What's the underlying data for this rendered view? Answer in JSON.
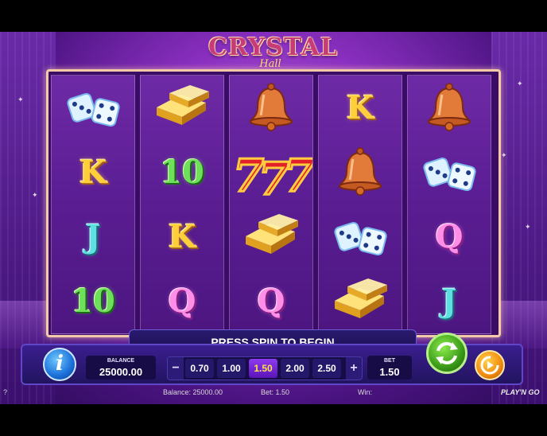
{
  "game": {
    "logo_main": "CRYSTAL",
    "logo_sub": "Hall"
  },
  "reels": [
    [
      "dice",
      "K",
      "J",
      "10"
    ],
    [
      "gold",
      "10",
      "K",
      "Q"
    ],
    [
      "bell",
      "seven",
      "gold",
      "Q"
    ],
    [
      "K",
      "bell",
      "dice",
      "gold"
    ],
    [
      "bell",
      "dice",
      "Q",
      "J"
    ]
  ],
  "message": "PRESS SPIN TO BEGIN",
  "controls": {
    "info_label": "i",
    "balance_label": "BALANCE",
    "balance_value": "25000.00",
    "bet_label": "BET",
    "bet_value": "1.50",
    "bet_minus": "−",
    "bet_plus": "+",
    "bet_options": [
      "0.70",
      "1.00",
      "1.50",
      "2.00",
      "2.50"
    ],
    "selected_bet": "1.50"
  },
  "footer": {
    "help": "?",
    "balance": "Balance: 25000.00",
    "bet": "Bet: 1.50",
    "win": "Win:",
    "brand": "PLAY'N GO"
  },
  "colors": {
    "accent": "#8e3af0",
    "spin": "#3a9a18",
    "autoplay": "#f08a10",
    "info": "#1a6fd8"
  }
}
